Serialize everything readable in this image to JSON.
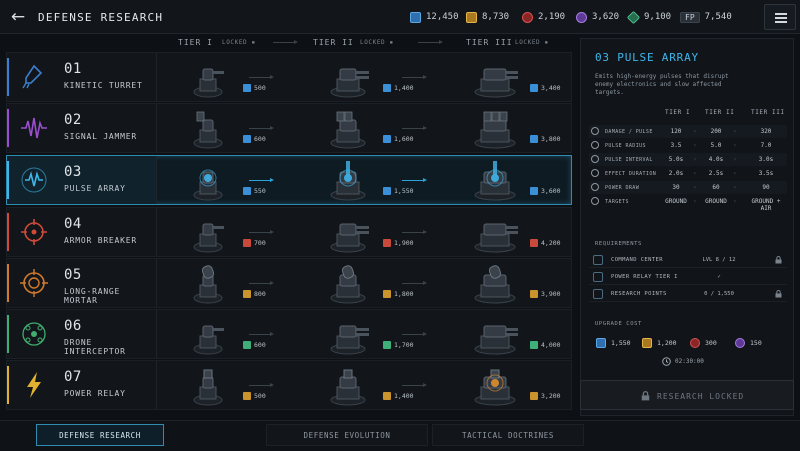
{
  "header": {
    "title": "DEFENSE RESEARCH",
    "currencies": [
      {
        "icon": "credits-icon",
        "value": "12,450",
        "color": "#3b8fd6"
      },
      {
        "icon": "gold-icon",
        "value": "8,730",
        "color": "#c9942e"
      },
      {
        "icon": "ruby-icon",
        "value": "2,190",
        "color": "#b83a3a"
      },
      {
        "icon": "orb-icon",
        "value": "3,620",
        "color": "#8b5ad1"
      },
      {
        "icon": "crystal-icon",
        "value": "9,100",
        "color": "#3fae78"
      }
    ],
    "fp_label": "FP",
    "fp_value": "7,540"
  },
  "tiers": {
    "tier1": "TIER I",
    "tier2": "TIER II",
    "tier3": "TIER III",
    "locked": "LOCKED"
  },
  "rows": [
    {
      "num": "01",
      "name": "KINETIC TURRET",
      "icon": "rocket-icon",
      "accent": "#3b7fd0",
      "costs": [
        "500",
        "1,400",
        "3,400"
      ]
    },
    {
      "num": "02",
      "name": "SIGNAL JAMMER",
      "icon": "signal-wave-icon",
      "accent": "#9a4fd0",
      "costs": [
        "600",
        "1,600",
        "3,800"
      ]
    },
    {
      "num": "03",
      "name": "PULSE ARRAY",
      "icon": "pulse-icon",
      "accent": "#3fb6ea",
      "costs": [
        "550",
        "1,550",
        "3,600"
      ]
    },
    {
      "num": "04",
      "name": "ARMOR BREAKER",
      "icon": "crosshair-icon",
      "accent": "#d04a3a",
      "costs": [
        "700",
        "1,900",
        "4,200"
      ]
    },
    {
      "num": "05",
      "name": "LONG-RANGE MORTAR",
      "icon": "target-icon",
      "accent": "#d07a2e",
      "costs": [
        "800",
        "1,800",
        "3,900"
      ]
    },
    {
      "num": "06",
      "name": "DRONE INTERCEPTOR",
      "icon": "drone-icon",
      "accent": "#3fae6e",
      "costs": [
        "600",
        "1,700",
        "4,000"
      ]
    },
    {
      "num": "07",
      "name": "POWER RELAY",
      "icon": "lightning-icon",
      "accent": "#e0b02e",
      "costs": [
        "500",
        "1,400",
        "3,200"
      ]
    }
  ],
  "detail": {
    "title": "03 PULSE ARRAY",
    "description": "Emits high-energy pulses that disrupt enemy electronics and slow affected targets.",
    "stat_headers": [
      "TIER I",
      "TIER II",
      "TIER III"
    ],
    "stats": [
      {
        "label": "DAMAGE / PULSE",
        "values": [
          "120",
          "200",
          "320"
        ]
      },
      {
        "label": "PULSE RADIUS",
        "values": [
          "3.5",
          "5.0",
          "7.0"
        ]
      },
      {
        "label": "PULSE INTERVAL",
        "values": [
          "5.0s",
          "4.0s",
          "3.0s"
        ]
      },
      {
        "label": "EFFECT DURATION",
        "values": [
          "2.0s",
          "2.5s",
          "3.5s"
        ]
      },
      {
        "label": "POWER DRAW",
        "values": [
          "30",
          "60",
          "90"
        ]
      },
      {
        "label": "TARGETS",
        "values": [
          "GROUND",
          "GROUND",
          "GROUND + AIR"
        ]
      }
    ],
    "requirements_label": "REQUIREMENTS",
    "requirements": [
      {
        "label": "COMMAND CENTER",
        "value": "LVL 8 / 12"
      },
      {
        "label": "POWER RELAY TIER I",
        "value": "✓"
      },
      {
        "label": "RESEARCH POINTS",
        "value": "0 / 1,550"
      }
    ],
    "upgrade_label": "UPGRADE COST",
    "upgrade_costs": [
      "1,550",
      "1,200",
      "300",
      "150"
    ],
    "timer": "02:30:00",
    "locked_button": "RESEARCH LOCKED"
  },
  "tabs": [
    "DEFENSE RESEARCH",
    "DEFENSE EVOLUTION",
    "TACTICAL DOCTRINES"
  ]
}
